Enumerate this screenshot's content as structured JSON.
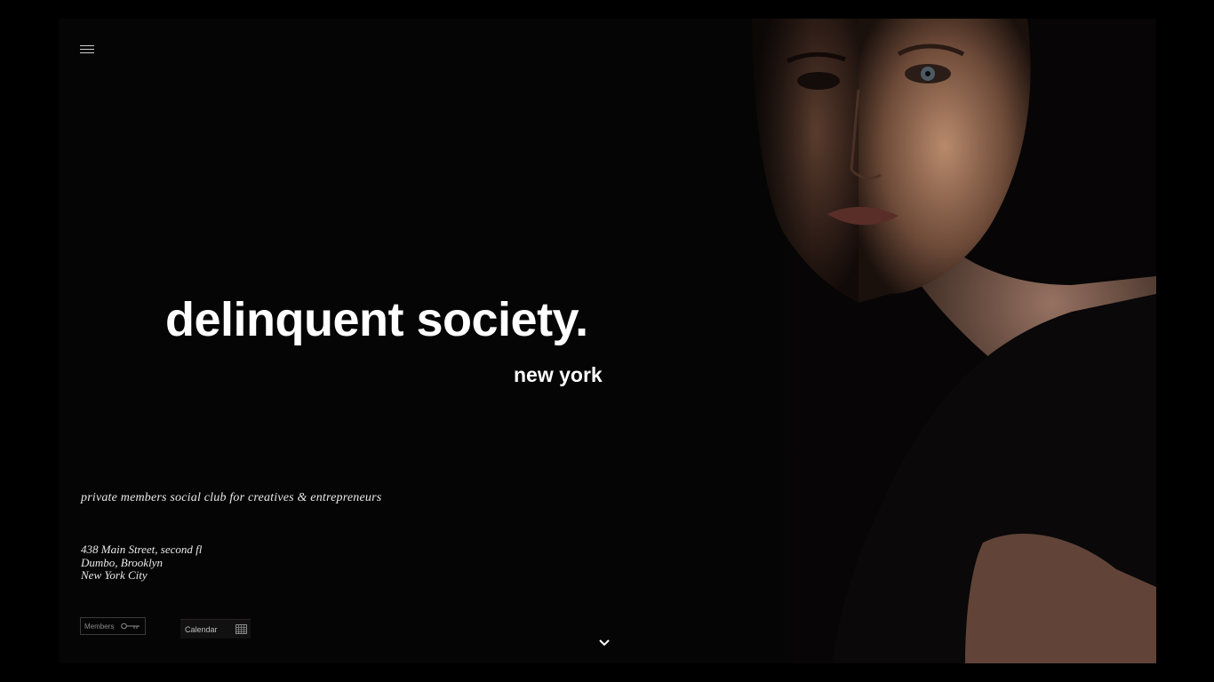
{
  "hero": {
    "title": "delinquent society.",
    "subtitle": "new york",
    "tagline": "private members social club for creatives & entrepreneurs"
  },
  "address": {
    "line1": "438 Main Street, second fl",
    "line2": "Dumbo, Brooklyn",
    "line3": "New York City"
  },
  "buttons": {
    "members_label": "Members",
    "calendar_label": "Calendar"
  },
  "icons": {
    "menu": "hamburger-icon",
    "members": "key-icon",
    "calendar": "calendar-grid-icon",
    "scroll": "chevron-down-icon"
  },
  "colors": {
    "background": "#000000",
    "text": "#ffffff"
  }
}
